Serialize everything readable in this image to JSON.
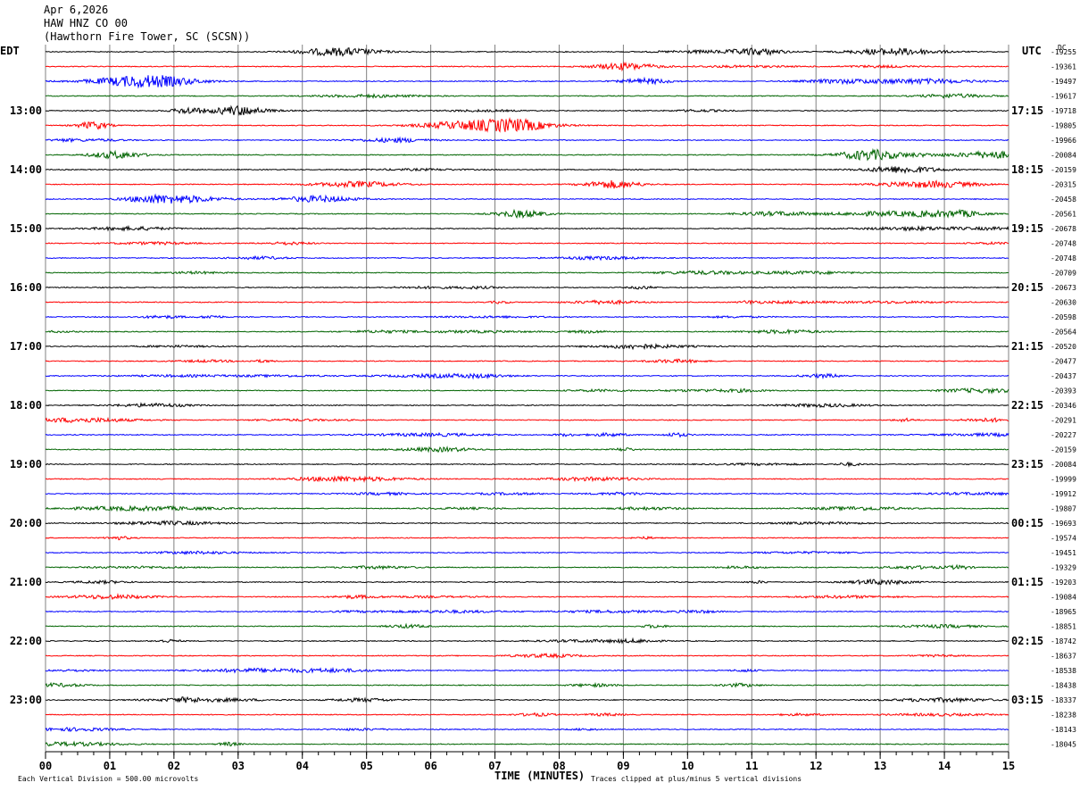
{
  "header": {
    "date": "Apr 6,2026",
    "station": "HAW HNZ CO 00",
    "location": "(Hawthorn Fire Tower, SC (SCSN))"
  },
  "left_tz": "EDT",
  "right_tz": "UTC",
  "dc_label": "DC",
  "footer": {
    "scale_note": "Each Vertical Division =  500.00 microvolts",
    "x_title": "TIME (MINUTES)",
    "clip_note": "Traces clipped at plus/minus 5 vertical divisions"
  },
  "colors": {
    "cycle": [
      "#000000",
      "#ff0000",
      "#0000ff",
      "#006400"
    ],
    "grid": "#808080"
  },
  "chart_data": {
    "type": "line",
    "xlabel": "TIME (MINUTES)",
    "xlim": [
      0,
      15
    ],
    "x_ticks": [
      "00",
      "01",
      "02",
      "03",
      "04",
      "05",
      "06",
      "07",
      "08",
      "09",
      "10",
      "11",
      "12",
      "13",
      "14",
      "15"
    ],
    "left_hour_labels": [
      "13:00",
      "14:00",
      "15:00",
      "16:00",
      "17:00",
      "18:00",
      "19:00",
      "20:00",
      "21:00",
      "22:00",
      "23:00"
    ],
    "right_hour_labels": [
      "17:15",
      "18:15",
      "19:15",
      "20:15",
      "21:15",
      "22:15",
      "23:15",
      "00:15",
      "01:15",
      "02:15",
      "03:15"
    ],
    "dc_offsets": [
      "-19255",
      "-19361",
      "-19497",
      "-19617",
      "-19718",
      "-19805",
      "-19966",
      "-20084",
      "-20159",
      "-20315",
      "-20458",
      "-20561",
      "-20678",
      "-20748",
      "-20748",
      "-20709",
      "-20673",
      "-20630",
      "-20598",
      "-20564",
      "-20520",
      "-20477",
      "-20437",
      "-20393",
      "-20346",
      "-20291",
      "-20227",
      "-20159",
      "-20084",
      "-19999",
      "-19912",
      "-19807",
      "-19693",
      "-19574",
      "-19451",
      "-19329",
      "-19203",
      "-19084",
      "-18965",
      "-18851",
      "-18742",
      "-18637",
      "-18538",
      "-18438",
      "-18337",
      "-18238",
      "-18143",
      "-18045"
    ],
    "num_traces": 48,
    "trace_minutes": 15
  }
}
